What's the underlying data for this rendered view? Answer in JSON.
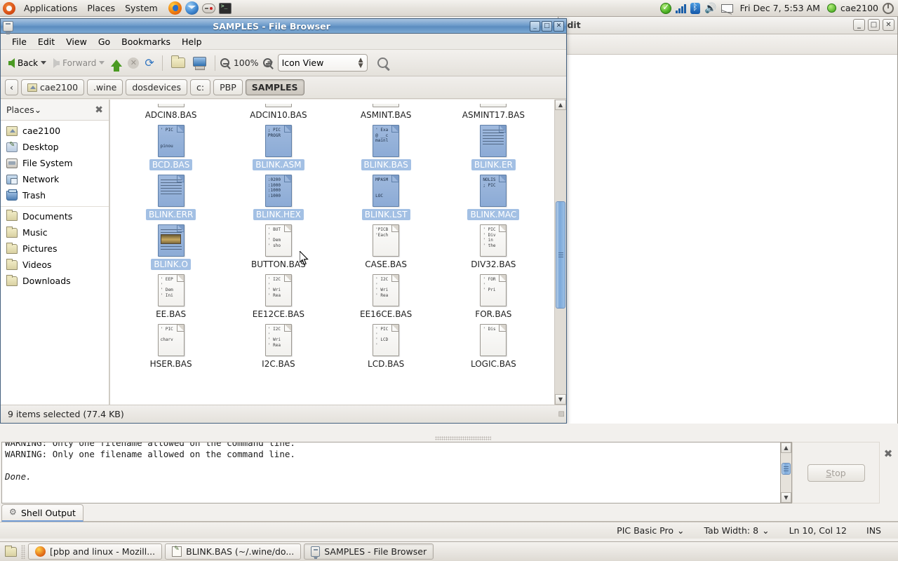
{
  "panel": {
    "logo": "ubuntu-logo",
    "menus": [
      "Applications",
      "Places",
      "System"
    ],
    "launchers": [
      "firefox-icon",
      "thunderbird-icon",
      "gamepad-icon",
      "terminal-icon"
    ],
    "tray": {
      "update_icon": "update-manager-icon",
      "network_icon": "network-signal-icon",
      "bluetooth_icon": "bluetooth-icon",
      "volume_icon": "volume-icon",
      "mail_icon": "mail-icon",
      "clock": "Fri Dec  7,  5:53 AM",
      "user": "cae2100",
      "power_icon": "power-icon"
    }
  },
  "background_window": {
    "title": "edit",
    "minimize": "_",
    "maximize": "□",
    "close": "✕"
  },
  "file_browser": {
    "title": "SAMPLES - File Browser",
    "window_buttons": {
      "minimize": "_",
      "maximize": "□",
      "close": "✕"
    },
    "menus": [
      "File",
      "Edit",
      "View",
      "Go",
      "Bookmarks",
      "Help"
    ],
    "toolbar": {
      "back_label": "Back",
      "forward_label": "Forward",
      "up_icon": "go-up-icon",
      "stop_icon": "stop-icon",
      "reload_icon": "reload-icon",
      "home_folder_icon": "folder-icon",
      "computer_icon": "computer-icon",
      "zoom_out_icon": "zoom-out-icon",
      "zoom_level": "100%",
      "zoom_in_icon": "zoom-in-icon",
      "view_mode": "Icon View",
      "search_icon": "search-icon"
    },
    "pathbar": {
      "back_chevron": "‹",
      "crumbs": [
        "cae2100",
        ".wine",
        "dosdevices",
        "c:",
        "PBP",
        "SAMPLES"
      ],
      "current": "SAMPLES"
    },
    "sidebar": {
      "header": "Places",
      "header_caret": "⌄",
      "close_icon": "close-sidebar-icon",
      "items": [
        {
          "label": "cae2100",
          "icon": "home-folder-icon"
        },
        {
          "label": "Desktop",
          "icon": "desktop-icon"
        },
        {
          "label": "File System",
          "icon": "drive-icon"
        },
        {
          "label": "Network",
          "icon": "network-icon"
        },
        {
          "label": "Trash",
          "icon": "trash-icon"
        }
      ],
      "items2": [
        {
          "label": "Documents",
          "icon": "folder-icon"
        },
        {
          "label": "Music",
          "icon": "folder-icon"
        },
        {
          "label": "Pictures",
          "icon": "folder-icon"
        },
        {
          "label": "Videos",
          "icon": "folder-icon"
        },
        {
          "label": "Downloads",
          "icon": "folder-icon"
        }
      ]
    },
    "files": {
      "row0": [
        {
          "name": "ADCIN8.BAS",
          "selected": false,
          "preview": "",
          "clipped": true
        },
        {
          "name": "ADCIN10.BAS",
          "selected": false,
          "preview": "",
          "clipped": true
        },
        {
          "name": "ASMINT.BAS",
          "selected": false,
          "preview": "",
          "clipped": true
        },
        {
          "name": "ASMINT17.BAS",
          "selected": false,
          "preview": "",
          "clipped": true
        }
      ],
      "row1": [
        {
          "name": "BCD.BAS",
          "selected": true,
          "preview": "' PIC\n\n\npinou"
        },
        {
          "name": "BLINK.ASM",
          "selected": true,
          "preview": "; PIC\nPROGR"
        },
        {
          "name": "BLINK.BAS",
          "selected": true,
          "preview": "' Exa\n@ __c\nmainl"
        },
        {
          "name": "BLINK.ER",
          "selected": true,
          "preview": "lines"
        }
      ],
      "row2": [
        {
          "name": "BLINK.ERR",
          "selected": true,
          "preview": "lines"
        },
        {
          "name": "BLINK.HEX",
          "selected": true,
          "preview": ":0200\n:1000\n:1000\n:1000"
        },
        {
          "name": "BLINK.LST",
          "selected": true,
          "preview": "MPASM\n\n\nLOC"
        },
        {
          "name": "BLINK.MAC",
          "selected": true,
          "preview": "NOLIS\n; PIC"
        }
      ],
      "row3": [
        {
          "name": "BLINK.O",
          "selected": true,
          "preview": "thumb"
        },
        {
          "name": "BUTTON.BAS",
          "selected": false,
          "preview": "' BUT\n'\n' Dem\n' sho"
        },
        {
          "name": "CASE.BAS",
          "selected": false,
          "preview": "'PICB\n'Each"
        },
        {
          "name": "DIV32.BAS",
          "selected": false,
          "preview": "' PIC\n' Div\n' in\n' the"
        }
      ],
      "row4": [
        {
          "name": "EE.BAS",
          "selected": false,
          "preview": "' EEP\n'\n' Dem\n' Ini"
        },
        {
          "name": "EE12CE.BAS",
          "selected": false,
          "preview": "' I2C\n'\n' Wri\n' Rea"
        },
        {
          "name": "EE16CE.BAS",
          "selected": false,
          "preview": "' I2C\n'\n' Wri\n' Rea"
        },
        {
          "name": "FOR.BAS",
          "selected": false,
          "preview": "' FOR\n'\n' Pri"
        }
      ],
      "row5": [
        {
          "name": "HSER.BAS",
          "selected": false,
          "preview": "' PIC\n\ncharv"
        },
        {
          "name": "I2C.BAS",
          "selected": false,
          "preview": "' I2C\n'\n' Wri\n' Rea"
        },
        {
          "name": "LCD.BAS",
          "selected": false,
          "preview": "' PIC\n'\n' LCD\n'"
        },
        {
          "name": "LOGIC.BAS",
          "selected": false,
          "preview": "' Dis"
        }
      ]
    },
    "status": "9 items selected (77.4 KB)"
  },
  "editor": {
    "shell_output": {
      "line_clipped": "WARNING: Only one filename allowed on the command line.",
      "line2": "WARNING: Only one filename allowed on the command line.",
      "line3": "",
      "line4": "Done."
    },
    "stop_button": "Stop",
    "close_pane_icon": "close-pane-icon",
    "tab": {
      "label": "Shell Output",
      "icon": "gear-icon"
    },
    "status": {
      "language": "PIC Basic Pro",
      "language_caret": "⌄",
      "tab_width": "Tab Width:  8",
      "tab_width_caret": "⌄",
      "position": "Ln 10, Col 12",
      "insert_mode": "INS"
    }
  },
  "taskbar": {
    "show_desktop_icon": "show-desktop-icon",
    "windows": [
      {
        "label": "[pbp and linux - Mozill...",
        "icon": "firefox-icon",
        "active": false
      },
      {
        "label": "BLINK.BAS (~/.wine/do...",
        "icon": "editor-icon",
        "active": false
      },
      {
        "label": "SAMPLES - File Browser",
        "icon": "file-browser-icon",
        "active": true
      }
    ]
  }
}
